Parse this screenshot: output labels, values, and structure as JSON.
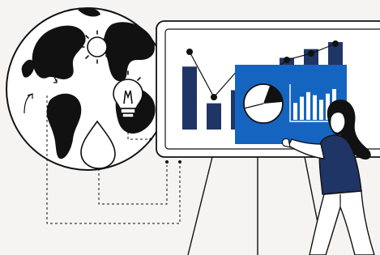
{
  "colors": {
    "background": "#f5f4f2",
    "outline": "#111111",
    "navy": "#1f3566",
    "blue": "#1565c0",
    "white": "#ffffff"
  },
  "icons": [
    "globe-icon",
    "sun-icon",
    "water-drop-icon",
    "light-bulb-icon",
    "pie-chart-icon",
    "bar-chart-icon"
  ],
  "board_chart": {
    "bar_levels": [
      0.72,
      0.3,
      0.45,
      0.62,
      0.82,
      0.92,
      1.0
    ],
    "line_points": [
      0.88,
      0.32,
      0.66,
      0.52,
      0.78,
      0.86,
      0.98
    ]
  },
  "panel_chart": {
    "pie_fractions": [
      0.18,
      0.82
    ],
    "bar_levels": [
      0.55,
      0.75,
      0.9,
      0.8,
      0.65,
      0.85,
      1.0
    ]
  }
}
